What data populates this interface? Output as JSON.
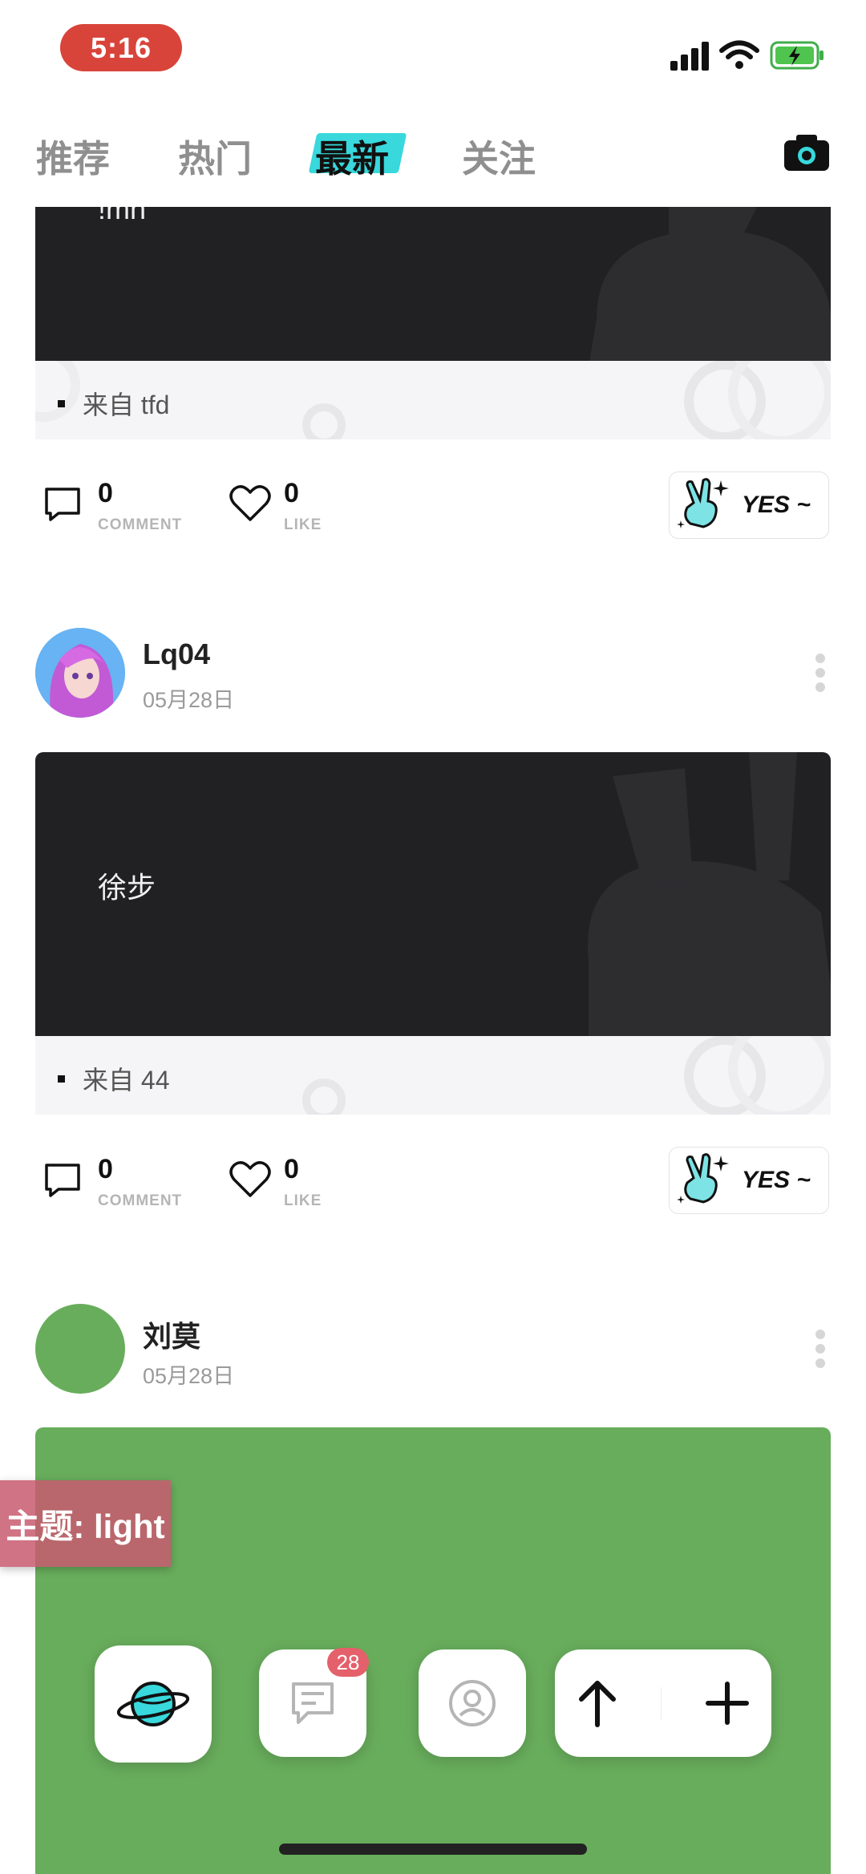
{
  "status_bar": {
    "time": "5:16"
  },
  "tabs": [
    {
      "label": "推荐"
    },
    {
      "label": "热门"
    },
    {
      "label": "最新"
    },
    {
      "label": "关注"
    }
  ],
  "posts": [
    {
      "body_text": "!mh",
      "source": "来自 tfd",
      "comment_count": "0",
      "comment_label": "COMMENT",
      "like_count": "0",
      "like_label": "LIKE",
      "reaction_label": "YES ~"
    },
    {
      "username": "Lq04",
      "date": "05月28日",
      "body_text": "徐步",
      "source": "来自 44",
      "comment_count": "0",
      "comment_label": "COMMENT",
      "like_count": "0",
      "like_label": "LIKE",
      "reaction_label": "YES ~"
    },
    {
      "username": "刘莫",
      "date": "05月28日",
      "card_color": "#68ad5c"
    }
  ],
  "theme_tag": "主题: light",
  "bottom_nav": {
    "messages_badge": "28"
  },
  "colors": {
    "accent": "#38d8dc",
    "badge": "#e4606a",
    "time_pill": "#d9443a"
  }
}
